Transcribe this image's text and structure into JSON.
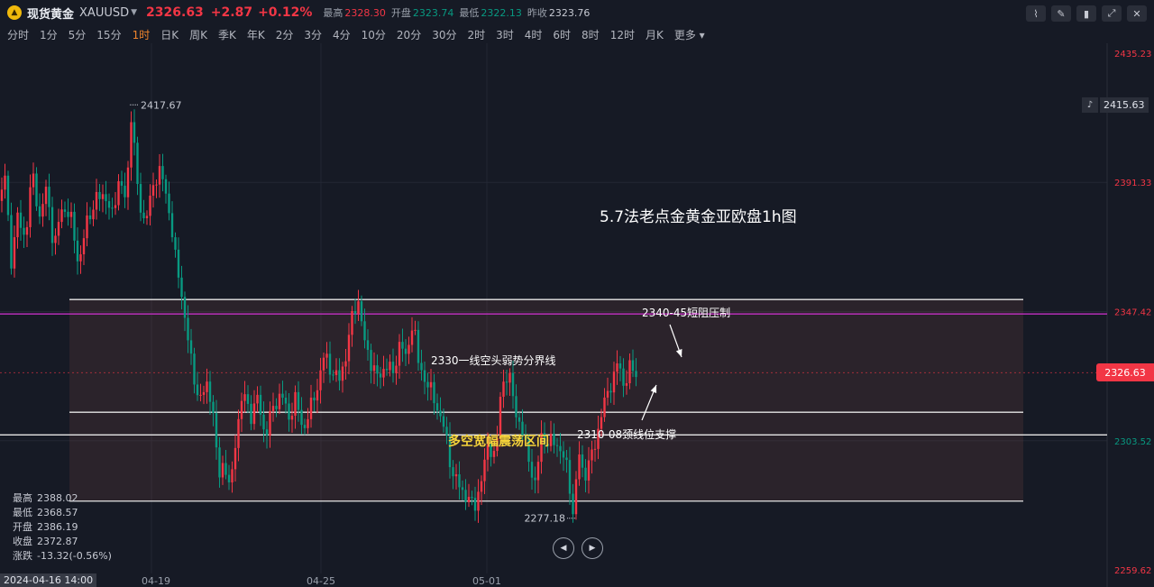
{
  "header": {
    "symbol_name": "现货黄金",
    "symbol_code": "XAUUSD",
    "price": "2326.63",
    "change": "+2.87",
    "change_pct": "+0.12%",
    "high_label": "最高",
    "high": "2328.30",
    "open_label": "开盘",
    "open": "2323.74",
    "low_label": "最低",
    "low": "2322.13",
    "prev_label": "昨收",
    "prev": "2323.76"
  },
  "intervals": [
    "分时",
    "1分",
    "5分",
    "15分",
    "1时",
    "日K",
    "周K",
    "季K",
    "年K",
    "2分",
    "3分",
    "4分",
    "10分",
    "20分",
    "30分",
    "2时",
    "3时",
    "4时",
    "6时",
    "8时",
    "12时",
    "月K",
    "更多"
  ],
  "active_interval": "1时",
  "ohlc_panel": {
    "high_label": "最高",
    "high": "2388.02",
    "low_label": "最低",
    "low": "2368.57",
    "open_label": "开盘",
    "open": "2386.19",
    "close_label": "收盘",
    "close": "2372.87",
    "chg_label": "涨跌",
    "chg": "-13.32(-0.56%)"
  },
  "time_hover": "2024-04-16 14:00",
  "price_axis": {
    "top": "2435.23",
    "l2": "2391.33",
    "l3": "2347.42",
    "l4": "2303.52",
    "bottom": "2259.62",
    "current": "2326.63",
    "alert": "2415.63"
  },
  "colors": {
    "up": "#f23645",
    "down": "#089981",
    "band_line": "#e6e6e6",
    "magenta": "#c330c3",
    "yellow_text": "#f5d33a"
  },
  "chart_data": {
    "type": "candlestick",
    "timeframe": "1h",
    "x_ticks": [
      "04-19",
      "04-25",
      "05-01"
    ],
    "ylim": [
      2259.62,
      2435.23
    ],
    "y_ticks": [
      2435.23,
      2391.33,
      2347.42,
      2303.52,
      2259.62
    ],
    "current_price": 2326.63,
    "extremes": {
      "high": 2417.67,
      "low": 2277.18
    },
    "horizontal_lines": [
      {
        "price": 2351.5,
        "color": "#e6e6e6"
      },
      {
        "price": 2346.6,
        "color": "#c330c3"
      },
      {
        "price": 2313.2,
        "color": "#e6e6e6"
      },
      {
        "price": 2305.5,
        "color": "#e6e6e6"
      },
      {
        "price": 2283.0,
        "color": "#e6e6e6"
      }
    ],
    "zone": {
      "from": 2283.0,
      "to": 2351.5
    },
    "path": [
      [
        0,
        2385
      ],
      [
        6,
        2394
      ],
      [
        12,
        2364
      ],
      [
        20,
        2380
      ],
      [
        28,
        2372
      ],
      [
        36,
        2395
      ],
      [
        44,
        2379
      ],
      [
        52,
        2390
      ],
      [
        60,
        2368
      ],
      [
        68,
        2383
      ],
      [
        78,
        2380
      ],
      [
        88,
        2363
      ],
      [
        96,
        2378
      ],
      [
        106,
        2385
      ],
      [
        116,
        2388
      ],
      [
        124,
        2379
      ],
      [
        132,
        2393
      ],
      [
        140,
        2384
      ],
      [
        146,
        2417.67
      ],
      [
        152,
        2390
      ],
      [
        158,
        2378
      ],
      [
        166,
        2384
      ],
      [
        172,
        2392
      ],
      [
        178,
        2397
      ],
      [
        184,
        2386
      ],
      [
        190,
        2378
      ],
      [
        196,
        2362
      ],
      [
        202,
        2352
      ],
      [
        208,
        2340
      ],
      [
        214,
        2325
      ],
      [
        222,
        2318
      ],
      [
        230,
        2322
      ],
      [
        236,
        2316
      ],
      [
        242,
        2290
      ],
      [
        248,
        2297
      ],
      [
        256,
        2286
      ],
      [
        262,
        2307
      ],
      [
        270,
        2320
      ],
      [
        278,
        2312
      ],
      [
        286,
        2318
      ],
      [
        294,
        2305
      ],
      [
        302,
        2314
      ],
      [
        312,
        2320
      ],
      [
        320,
        2311
      ],
      [
        328,
        2318
      ],
      [
        336,
        2307
      ],
      [
        344,
        2314
      ],
      [
        352,
        2322
      ],
      [
        360,
        2333
      ],
      [
        368,
        2327
      ],
      [
        376,
        2324
      ],
      [
        384,
        2333
      ],
      [
        392,
        2348
      ],
      [
        398,
        2351.2
      ],
      [
        404,
        2337
      ],
      [
        412,
        2330
      ],
      [
        420,
        2324
      ],
      [
        428,
        2330
      ],
      [
        436,
        2326
      ],
      [
        444,
        2338
      ],
      [
        450,
        2331
      ],
      [
        458,
        2345
      ],
      [
        464,
        2330
      ],
      [
        472,
        2324
      ],
      [
        480,
        2319
      ],
      [
        486,
        2314
      ],
      [
        494,
        2306
      ],
      [
        502,
        2292
      ],
      [
        510,
        2288
      ],
      [
        518,
        2284
      ],
      [
        526,
        2281
      ],
      [
        534,
        2290
      ],
      [
        542,
        2303
      ],
      [
        550,
        2297
      ],
      [
        556,
        2323
      ],
      [
        564,
        2326
      ],
      [
        572,
        2314
      ],
      [
        580,
        2305
      ],
      [
        588,
        2296
      ],
      [
        594,
        2287
      ],
      [
        600,
        2306
      ],
      [
        608,
        2302
      ],
      [
        616,
        2304
      ],
      [
        624,
        2298
      ],
      [
        630,
        2294
      ],
      [
        636,
        2277.18
      ],
      [
        642,
        2300
      ],
      [
        648,
        2291
      ],
      [
        656,
        2298
      ],
      [
        664,
        2308
      ],
      [
        670,
        2316
      ],
      [
        676,
        2322
      ],
      [
        682,
        2326
      ],
      [
        686,
        2331
      ],
      [
        692,
        2322
      ],
      [
        698,
        2328
      ],
      [
        704,
        2327
      ],
      [
        708,
        2326.63
      ]
    ]
  },
  "annotations": {
    "title": "5.7法老点金黄金亚欧盘1h图",
    "resistance": "2340-45短阻压制",
    "boundary": "2330一线空头弱势分界线",
    "range": "多空宽幅震荡区间",
    "support": "2310-08颈线位支撑",
    "high_mark": "2417.67",
    "low_mark": "2277.18"
  }
}
